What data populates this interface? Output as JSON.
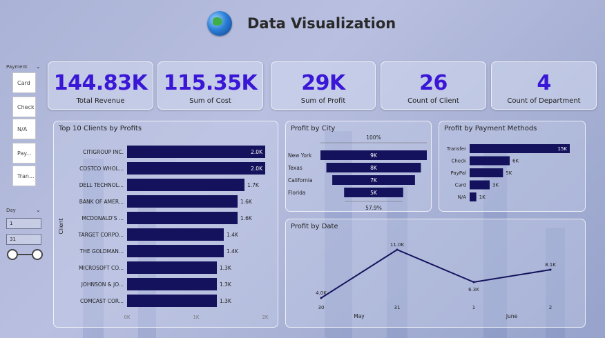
{
  "title": "Data Visualization",
  "payment_slicer": {
    "label": "Payment",
    "options": [
      "Card",
      "Check",
      "N/A",
      "Pay...",
      "Tran..."
    ]
  },
  "day_slicer": {
    "label": "Day",
    "from": "1",
    "to": "31"
  },
  "kpis": [
    {
      "value": "144.83K",
      "label": "Total Revenue"
    },
    {
      "value": "115.35K",
      "label": "Sum of Cost"
    },
    {
      "value": "29K",
      "label": "Sum of Profit"
    },
    {
      "value": "26",
      "label": "Count of Client"
    },
    {
      "value": "4",
      "label": "Count of Department"
    }
  ],
  "colors": {
    "kpi_value": "#3a17d6",
    "bar": "#14125c"
  },
  "chart_data": [
    {
      "type": "bar",
      "orientation": "horizontal",
      "title": "Top 10 Clients by Profits",
      "ylabel": "Client",
      "categories": [
        "CITIGROUP INC.",
        "COSTCO WHOL...",
        "DELL TECHNOL...",
        "BANK OF AMER...",
        "MCDONALD'S ...",
        "TARGET CORPO...",
        "THE GOLDMAN...",
        "MICROSOFT CO...",
        "JOHNSON & JO...",
        "COMCAST COR..."
      ],
      "values": [
        2.0,
        2.0,
        1.7,
        1.6,
        1.6,
        1.4,
        1.4,
        1.3,
        1.3,
        1.3
      ],
      "data_labels": [
        "2.0K",
        "2.0K",
        "1.7K",
        "1.6K",
        "1.6K",
        "1.4K",
        "1.4K",
        "1.3K",
        "1.3K",
        "1.3K"
      ],
      "xticks": [
        "0K",
        "1K",
        "2K"
      ],
      "xlim": [
        0,
        2
      ]
    },
    {
      "type": "funnel",
      "title": "Profit by City",
      "categories": [
        "New York",
        "Texas",
        "California",
        "Florida"
      ],
      "values": [
        9,
        8,
        7,
        5
      ],
      "data_labels": [
        "9K",
        "8K",
        "7K",
        "5K"
      ],
      "top_pct": "100%",
      "bottom_pct": "57.9%"
    },
    {
      "type": "bar",
      "orientation": "horizontal",
      "title": "Profit by Payment Methods",
      "categories": [
        "Transfer",
        "Check",
        "PayPal",
        "Card",
        "N/A"
      ],
      "values": [
        15,
        6,
        5,
        3,
        1
      ],
      "data_labels": [
        "15K",
        "6K",
        "5K",
        "3K",
        "1K"
      ]
    },
    {
      "type": "line",
      "title": "Profit by Date",
      "x": [
        "30",
        "31",
        "1",
        "2"
      ],
      "values": [
        4.0,
        11.0,
        6.3,
        8.1
      ],
      "data_labels": [
        "4.0K",
        "11.0K",
        "6.3K",
        "8.1K"
      ],
      "month_labels": [
        "May",
        "June"
      ]
    }
  ]
}
